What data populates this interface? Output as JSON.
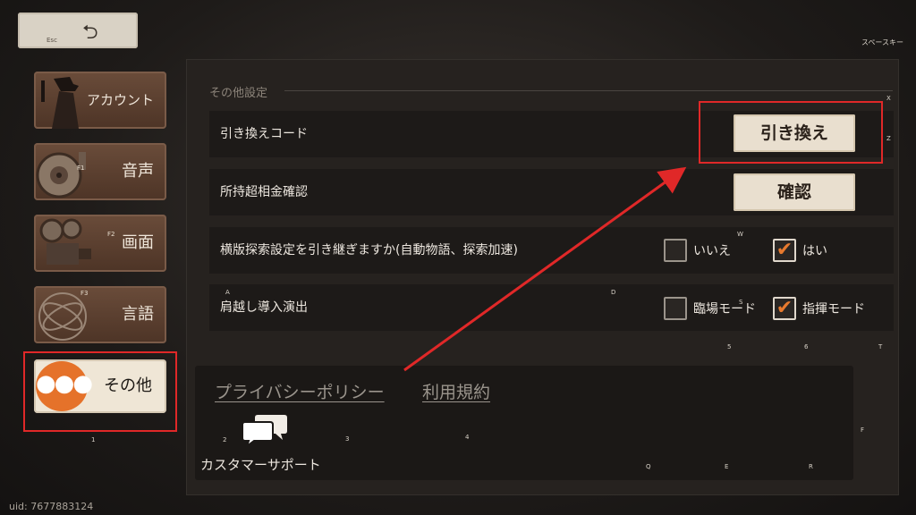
{
  "header": {
    "back_hotkey": "Esc",
    "back_icon": "return-arrow-icon",
    "space_hint": "スペースキー"
  },
  "sidebar": {
    "items": [
      {
        "label": "アカウント",
        "hotkey": ""
      },
      {
        "label": "音声",
        "hotkey": "F1"
      },
      {
        "label": "画面",
        "hotkey": "F2"
      },
      {
        "label": "言語",
        "hotkey": "F3"
      },
      {
        "label": "その他",
        "hotkey": "1"
      }
    ]
  },
  "main": {
    "section_title": "その他設定",
    "rows": {
      "redeem": {
        "label": "引き換えコード",
        "button": "引き換え",
        "hint": "Z"
      },
      "balance": {
        "label": "所持超相金確認",
        "button": "確認"
      },
      "inherit": {
        "label": "横版探索設定を引き継ぎますか(自動物語、探索加速)",
        "opt_no": "いいえ",
        "opt_yes": "はい",
        "no_checked": false,
        "yes_checked": true
      },
      "intro": {
        "label": "肩越し導入演出",
        "opt_a": "臨場モード",
        "opt_b": "指揮モード",
        "a_checked": false,
        "b_checked": true
      }
    },
    "links": {
      "privacy": "プライバシーポリシー",
      "terms": "利用規約"
    },
    "support": {
      "label": "カスタマーサポート",
      "icon": "chat-bubbles-icon"
    }
  },
  "key_hints": [
    "X",
    "Z",
    "W",
    "A",
    "D",
    "S",
    "5",
    "6",
    "T",
    "2",
    "3",
    "4",
    "F",
    "Q",
    "E",
    "R"
  ],
  "uid": "uid: 7677883124",
  "colors": {
    "accent": "#e5722a",
    "highlight": "#e02828",
    "ticket": "#e9dfcf"
  }
}
